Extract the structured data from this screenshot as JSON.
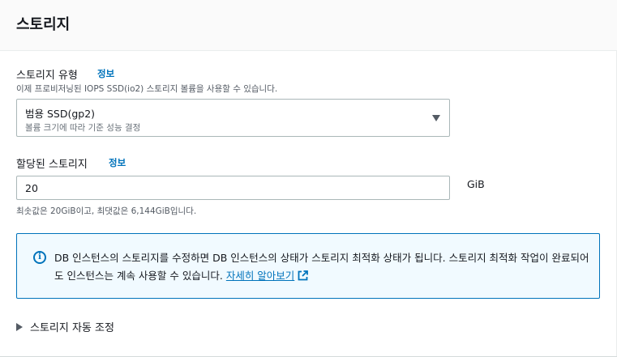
{
  "header": {
    "title": "스토리지"
  },
  "storage_type": {
    "label": "스토리지 유형",
    "info": "정보",
    "description": "이제 프로비저닝된 IOPS SSD(io2) 스토리지 볼륨을 사용할 수 있습니다.",
    "selected_value": "범용 SSD(gp2)",
    "selected_description": "볼륨 크기에 따라 기준 성능 결정"
  },
  "allocated_storage": {
    "label": "할당된 스토리지",
    "info": "정보",
    "value": "20",
    "unit": "GiB",
    "constraint": "최솟값은 20GiB이고, 최댓값은 6,144GiB입니다."
  },
  "alert": {
    "text": "DB 인스턴스의 스토리지를 수정하면 DB 인스턴스의 상태가 스토리지 최적화 상태가 됩니다. 스토리지 최적화 작업이 완료되어도 인스턴스는 계속 사용할 수 있습니다. ",
    "link": "자세히 알아보기"
  },
  "autoscaling": {
    "label": "스토리지 자동 조정"
  },
  "colors": {
    "link": "#0073bb",
    "alert_bg": "#f1faff",
    "border": "#aab7b8"
  },
  "icons": {
    "info": "info-circle-icon",
    "external": "external-link-icon",
    "caret_down": "caret-down-icon",
    "caret_right": "caret-right-icon"
  }
}
